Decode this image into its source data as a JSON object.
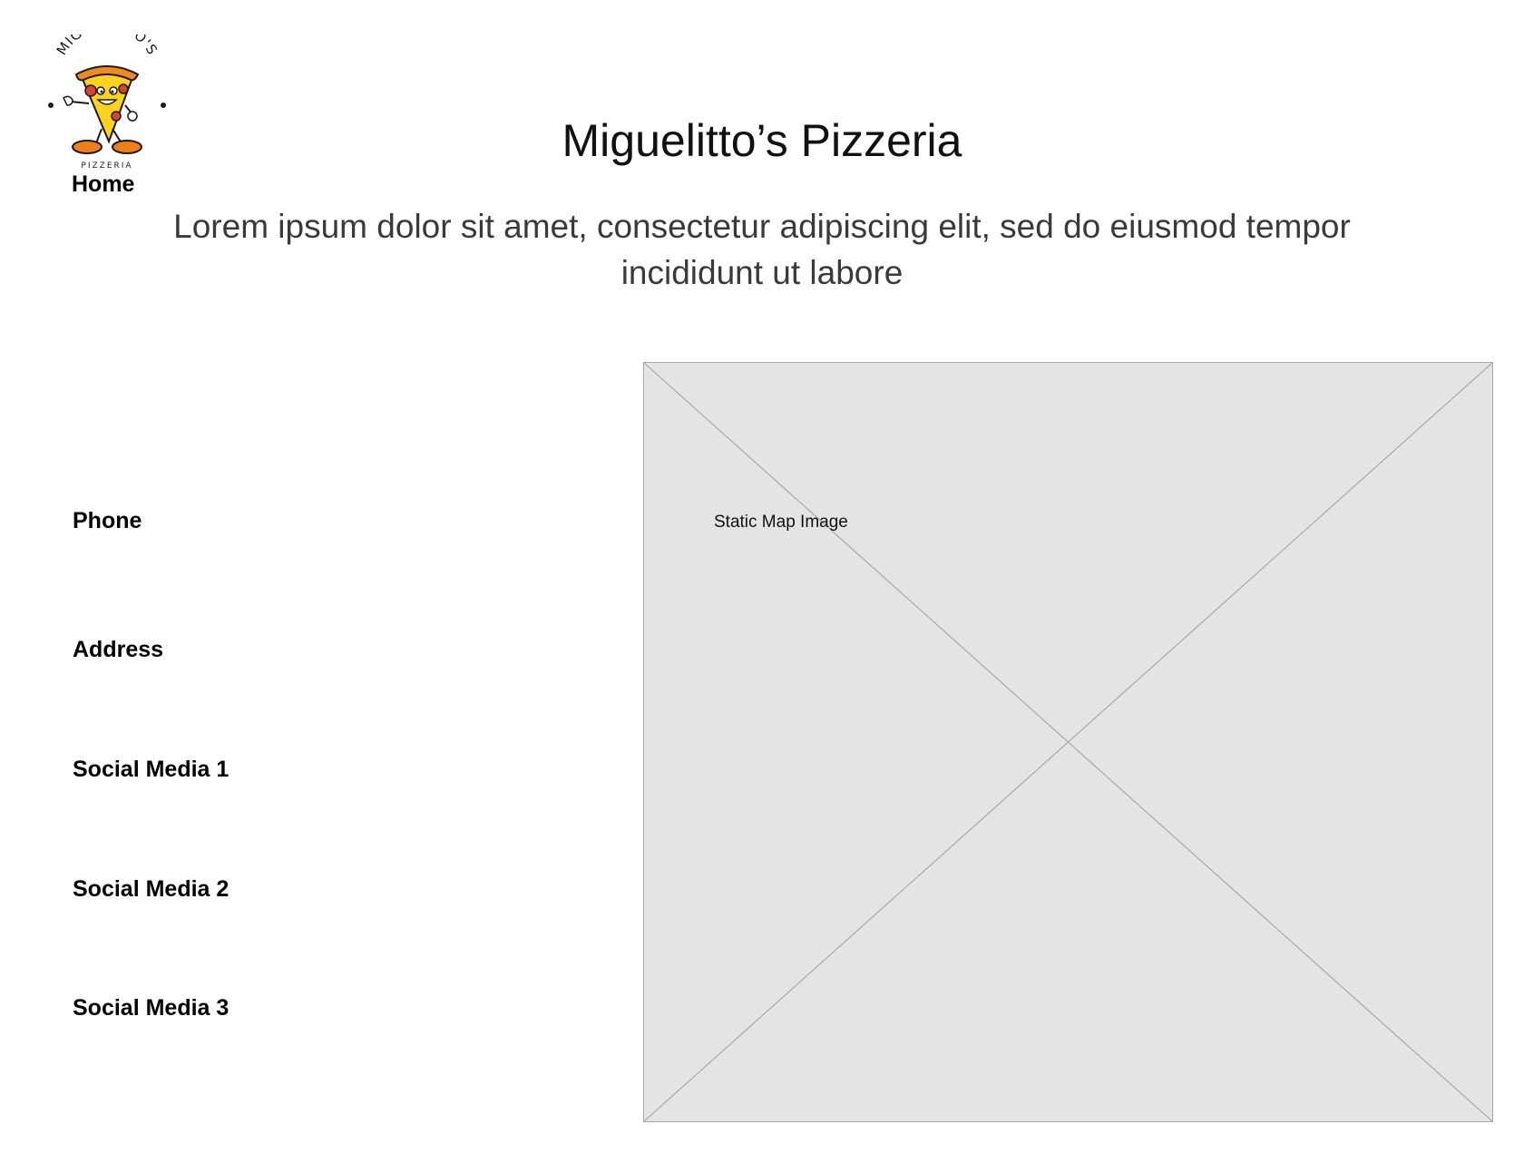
{
  "logo": {
    "arc_text": "MIGUELITTO'S",
    "sub_text": "PIZZERIA",
    "colors": {
      "crust": "#f08a1e",
      "cheese": "#ffd21f",
      "pepperoni": "#d9432f",
      "shoes": "#ef7f1a",
      "outline": "#1a1a1a"
    }
  },
  "nav": {
    "home_label": "Home"
  },
  "header": {
    "title": "Miguelitto’s Pizzeria",
    "subtitle": "Lorem ipsum dolor sit amet, consectetur adipiscing elit, sed do eiusmod tempor incididunt ut labore"
  },
  "contact": {
    "phone_label": "Phone",
    "address_label": "Address",
    "social_1_label": "Social Media 1",
    "social_2_label": "Social Media 2",
    "social_3_label": "Social Media 3"
  },
  "map": {
    "label": "Static Map Image",
    "placeholder_bg": "#e4e4e4",
    "line_color": "#a9a9a9"
  }
}
